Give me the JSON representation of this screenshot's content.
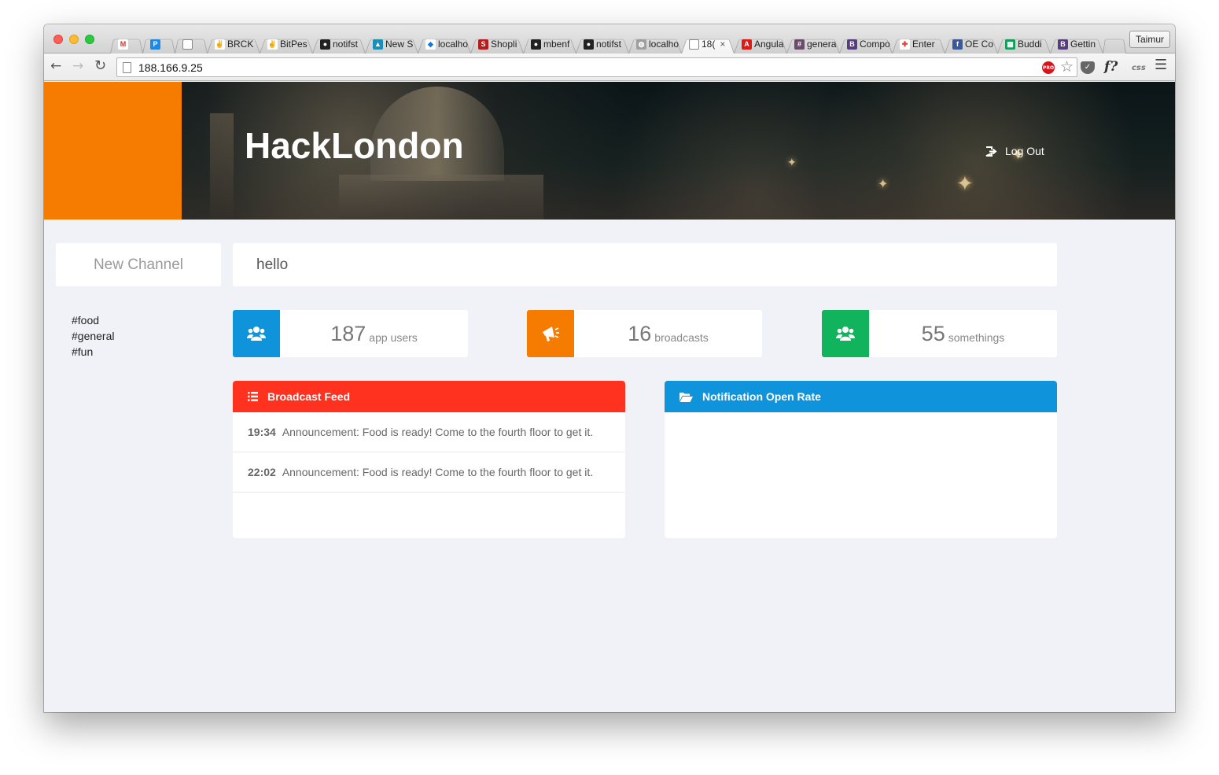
{
  "browser": {
    "tabs": [
      {
        "label": "",
        "favicon": "gmail-icon",
        "color": "#ffffff",
        "glyph": "M",
        "glyph_color": "#d93025"
      },
      {
        "label": "",
        "favicon": "p-circle-icon",
        "color": "#1e88e5",
        "glyph": "P"
      },
      {
        "label": "",
        "favicon": "blank-page-icon",
        "color": "#ffffff",
        "glyph": ""
      },
      {
        "label": "BRCK",
        "favicon": "peace-hand-icon",
        "color": "#ffffff",
        "glyph": "✌",
        "glyph_color": "#333333"
      },
      {
        "label": "BitPes",
        "favicon": "peace-hand-icon",
        "color": "#ffffff",
        "glyph": "✌",
        "glyph_color": "#333333"
      },
      {
        "label": "notifst",
        "favicon": "github-icon",
        "color": "#222222",
        "glyph": "●"
      },
      {
        "label": "New S",
        "favicon": "sail-icon",
        "color": "#1a8fb8",
        "glyph": "▲"
      },
      {
        "label": "localho",
        "favicon": "arrows-icon",
        "color": "#ffffff",
        "glyph": "◆",
        "glyph_color": "#1976d2"
      },
      {
        "label": "Shopli",
        "favicon": "s-icon",
        "color": "#b71c1c",
        "glyph": "S"
      },
      {
        "label": "mbenf",
        "favicon": "github-icon",
        "color": "#222222",
        "glyph": "●"
      },
      {
        "label": "notifst",
        "favicon": "github-icon",
        "color": "#222222",
        "glyph": "●"
      },
      {
        "label": "localho",
        "favicon": "globe-icon",
        "color": "#9e9e9e",
        "glyph": "◍"
      },
      {
        "label": "18(",
        "favicon": "blank-page-icon",
        "color": "#ffffff",
        "glyph": "",
        "active": true
      },
      {
        "label": "Angula",
        "favicon": "angular-icon",
        "color": "#dd1b16",
        "glyph": "A"
      },
      {
        "label": "genera",
        "favicon": "hash-icon",
        "color": "#6b4c6b",
        "glyph": "#"
      },
      {
        "label": "Compo",
        "favicon": "bootstrap-icon",
        "color": "#563d7c",
        "glyph": "B"
      },
      {
        "label": "Enter",
        "favicon": "pinwheel-icon",
        "color": "#ffffff",
        "glyph": "✚",
        "glyph_color": "#e53935"
      },
      {
        "label": "OE Co",
        "favicon": "facebook-icon",
        "color": "#3b5998",
        "glyph": "f"
      },
      {
        "label": "Buddi",
        "favicon": "sheets-icon",
        "color": "#0f9d58",
        "glyph": "▦"
      },
      {
        "label": "Gettin",
        "favicon": "bootstrap-icon",
        "color": "#563d7c",
        "glyph": "B"
      }
    ],
    "profile_name": "Taimur",
    "url": "188.166.9.25"
  },
  "header": {
    "title": "HackLondon",
    "logout_label": "Log Out"
  },
  "compose": {
    "new_channel_label": "New Channel",
    "message_value": "hello"
  },
  "channels": [
    "#food",
    "#general",
    "#fun"
  ],
  "stats": [
    {
      "value": "187",
      "label": "app users",
      "icon": "users-icon",
      "color": "#0f94dc"
    },
    {
      "value": "16",
      "label": "broadcasts",
      "icon": "megaphone-icon",
      "color": "#f57c00"
    },
    {
      "value": "55",
      "label": "somethings",
      "icon": "users-icon",
      "color": "#12b35d"
    }
  ],
  "broadcast_feed": {
    "title": "Broadcast Feed",
    "color": "#ff3220",
    "items": [
      {
        "time": "19:34",
        "text": "Announcement: Food is ready! Come to the fourth floor to get it."
      },
      {
        "time": "22:02",
        "text": "Announcement: Food is ready! Come to the fourth floor to get it."
      }
    ]
  },
  "open_rate": {
    "title": "Notification Open Rate",
    "color": "#0f94dc"
  }
}
